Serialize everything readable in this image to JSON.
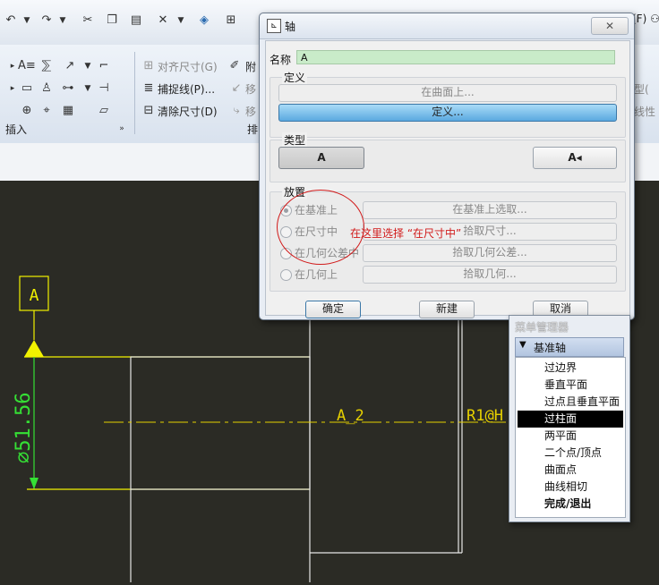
{
  "toolbar": {
    "undo_icon": "undo-icon",
    "redo_icon": "redo-icon",
    "cut_icon": "cut-icon",
    "copy_icon": "copy-icon",
    "paste_icon": "paste-icon",
    "delete_icon": "delete-x-icon",
    "right_edge_text": "(F) ⚇"
  },
  "ribbon": {
    "align_dimension": "对齐尺寸(G)",
    "capture_line": "捕捉线(P)...",
    "clear_dimension": "清除尺寸(D)",
    "attach_partial": "附",
    "move_partial_1": "移",
    "move_partial_2": "移",
    "arrange_partial": "排",
    "insert_group": "插入",
    "right_partial_1": "型(",
    "right_partial_2": "线性"
  },
  "dialog": {
    "title": "轴",
    "name_label": "名称",
    "name_value": "A",
    "define_legend": "定义",
    "on_surface_button": "在曲面上...",
    "define_button": "定义...",
    "type_legend": "类型",
    "type_a_button": "A",
    "type_a_arrow_button": "A◂",
    "placement_legend": "放置",
    "placement_options": [
      {
        "label": "在基准上",
        "button": "在基准上选取...",
        "checked": true
      },
      {
        "label": "在尺寸中",
        "button": "拾取尺寸...",
        "checked": false
      },
      {
        "label": "在几何公差中",
        "button": "拾取几何公差...",
        "checked": false
      },
      {
        "label": "在几何上",
        "button": "拾取几何...",
        "checked": false
      }
    ],
    "annotation": "在这里选择 “在尺寸中”",
    "ok_button": "确定",
    "new_button": "新建",
    "cancel_button": "取消"
  },
  "menu_manager": {
    "title": "菜单管理器",
    "header": "基准轴",
    "items": [
      {
        "label": "过边界",
        "selected": false
      },
      {
        "label": "垂直平面",
        "selected": false
      },
      {
        "label": "过点且垂直平面",
        "selected": false
      },
      {
        "label": "过柱面",
        "selected": true
      },
      {
        "label": "两平面",
        "selected": false
      },
      {
        "label": "二个点/顶点",
        "selected": false
      },
      {
        "label": "曲面点",
        "selected": false
      },
      {
        "label": "曲线相切",
        "selected": false
      },
      {
        "label": "完成/退出",
        "selected": false
      }
    ]
  },
  "drawing": {
    "datum_label": "A",
    "dimension_text": "⌀51.56",
    "axis_label": "A_2",
    "edge_text": "R1@H"
  },
  "colors": {
    "canvas_bg": "#2b2b25",
    "drawing_yellow": "#f2f200",
    "drawing_green": "#35e035",
    "drawing_white": "#e6e6e6",
    "annotation_red": "#d11a1a",
    "define_highlight": "#5ba9e0"
  }
}
